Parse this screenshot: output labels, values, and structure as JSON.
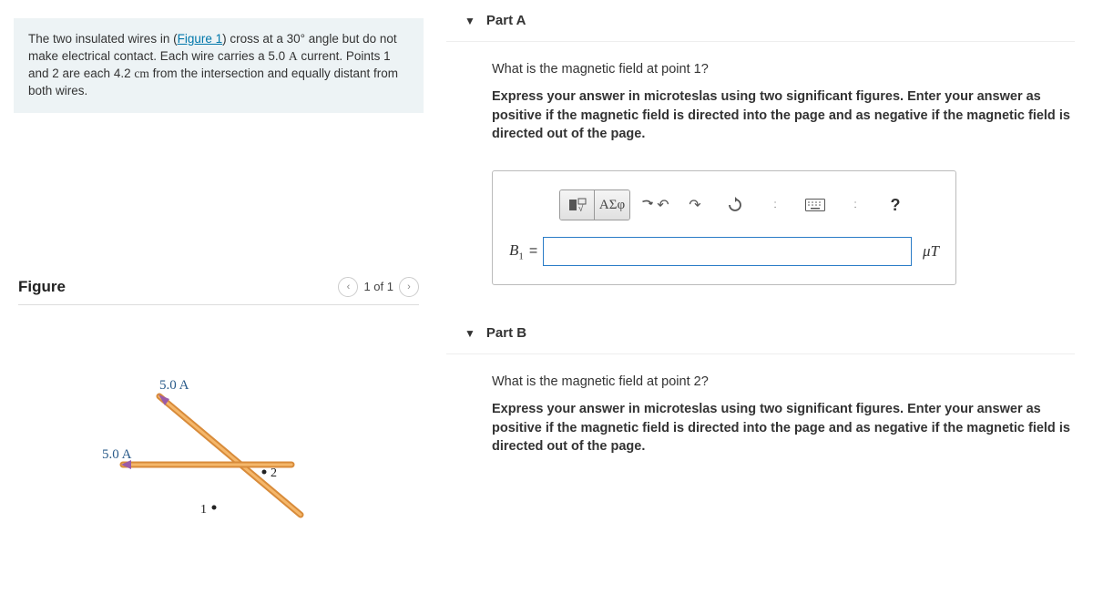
{
  "problem": {
    "text_before_link": "The two insulated wires in (",
    "link_text": "Figure 1",
    "text_after_link": ") cross at a 30° angle but do not make electrical contact. Each wire carries a 5.0 ",
    "unit_A": "A",
    "text_mid": " current. Points 1 and 2 are each 4.2 ",
    "unit_cm": "cm",
    "text_end": " from the intersection and equally distant from both wires."
  },
  "figure": {
    "title": "Figure",
    "nav_label": "1 of 1",
    "label_current_top": "5.0 A",
    "label_current_left": "5.0 A",
    "label_point1": "1",
    "label_point2": "2"
  },
  "partA": {
    "title": "Part A",
    "question": "What is the magnetic field at point 1?",
    "instruction": "Express your answer in microteslas using two significant figures. Enter your answer as positive if the magnetic field is directed into the page and as negative if the magnetic field is directed out of the page.",
    "variable": "B",
    "subscript": "1",
    "equals": "=",
    "unit": "μT",
    "value": "",
    "toolbar": {
      "greek": "ΑΣφ",
      "help": "?"
    }
  },
  "partB": {
    "title": "Part B",
    "question": "What is the magnetic field at point 2?",
    "instruction": "Express your answer in microteslas using two significant figures. Enter your answer as positive if the magnetic field is directed into the page and as negative if the magnetic field is directed out of the page."
  }
}
